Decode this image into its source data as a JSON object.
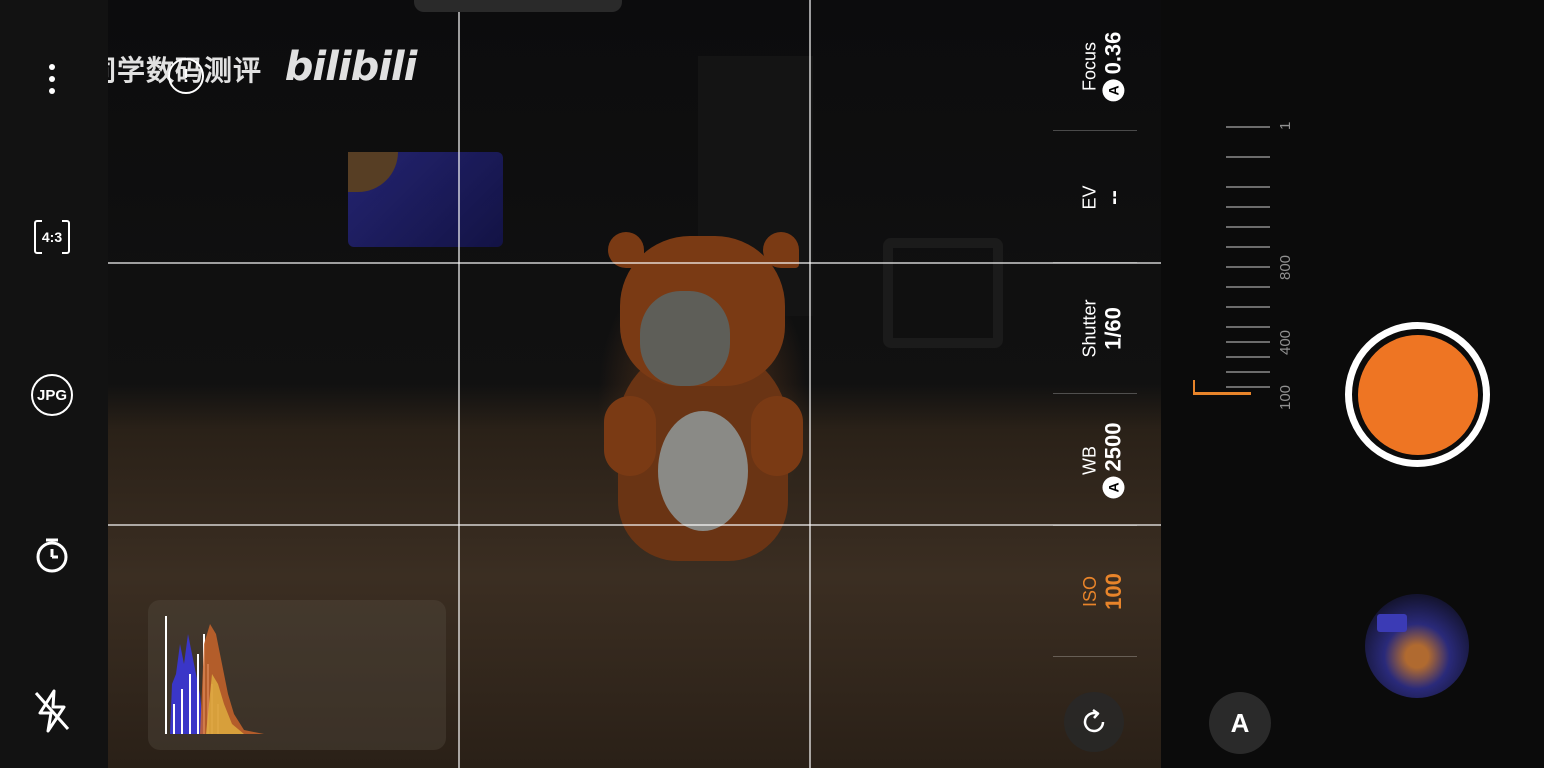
{
  "watermark": {
    "text": "小王同学数码测评",
    "logo": "bilibili"
  },
  "left_toolbar": {
    "aspect_label": "4:3",
    "format_label": "JPG"
  },
  "info_icon": {
    "glyph": "!"
  },
  "controls": {
    "focus": {
      "label": "Focus",
      "value": "0.36",
      "auto": "A"
    },
    "ev": {
      "label": "EV",
      "value": "--"
    },
    "shutter": {
      "label": "Shutter",
      "value": "1/60"
    },
    "wb": {
      "label": "WB",
      "value": "2500",
      "auto": "A"
    },
    "iso": {
      "label": "ISO",
      "value": "100"
    }
  },
  "iso_dial": {
    "labels": [
      "100",
      "400",
      "800",
      "1"
    ]
  },
  "mode_button": {
    "label": "A"
  },
  "colors": {
    "accent": "#ee7523",
    "active_param": "#e8842a",
    "panel_bg": "#121212"
  },
  "icons": [
    "more-vert-icon",
    "aspect-ratio-icon",
    "jpg-format-icon",
    "timer-icon",
    "flash-off-icon",
    "info-icon",
    "reset-icon"
  ]
}
